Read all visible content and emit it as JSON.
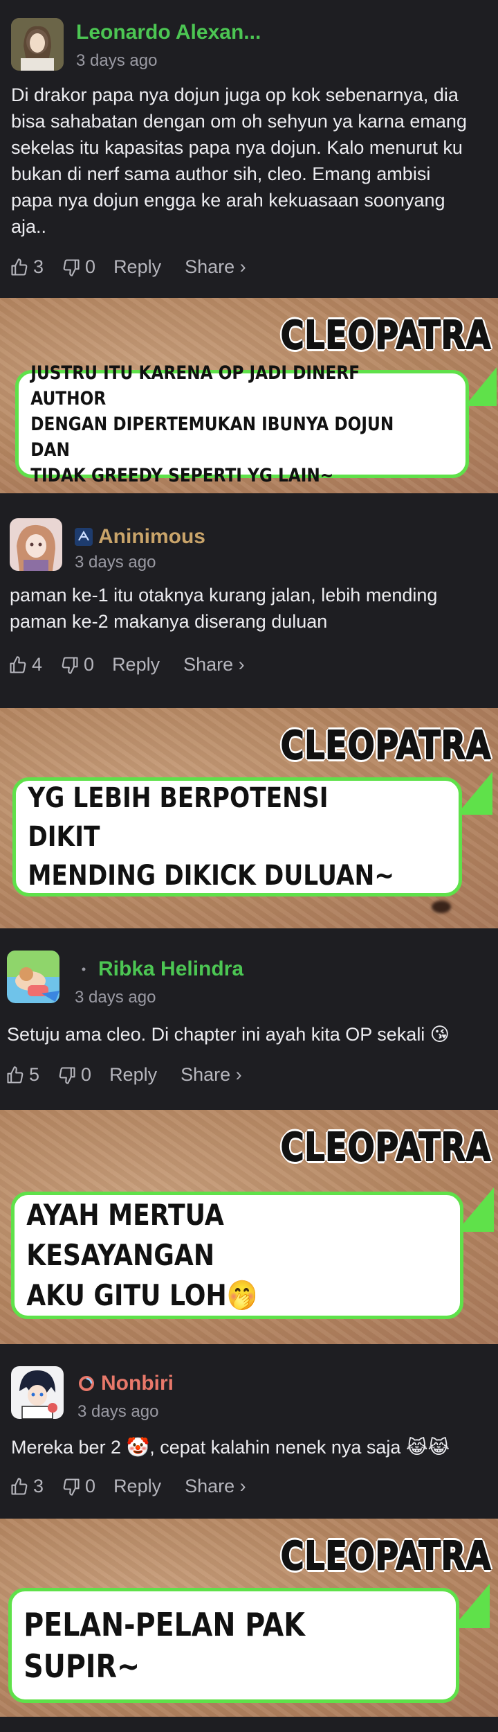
{
  "comments": [
    {
      "author": "Leonardo Alexan...",
      "author_color": "#4cc653",
      "time": "3 days ago",
      "body": "Di drakor papa nya dojun juga op kok sebenarnya, dia\nbisa sahabatan dengan om oh sehyun ya karna emang\nsekelas itu kapasitas papa nya dojun. Kalo menurut ku\nbukan di nerf sama author sih, cleo. Emang ambisi\npapa nya dojun engga ke arah kekuasaan soonyang\naja..",
      "likes": "3",
      "dislikes": "0",
      "reply": "Reply",
      "share": "Share ›",
      "avatar_icon": "user-avatar-icon"
    },
    {
      "author": "Aninimous",
      "author_color": "#c9a46a",
      "time": "3 days ago",
      "body": "paman ke-1 itu otaknya kurang jalan, lebih mending\npaman ke-2 makanya diserang duluan",
      "likes": "4",
      "dislikes": "0",
      "reply": "Reply",
      "share": "Share ›",
      "avatar_icon": "user-avatar-icon",
      "badge_icon": "ninja-badge-icon"
    },
    {
      "author": "Ribka Helindra",
      "author_color": "#4cc653",
      "time": "3 days ago",
      "body": "Setuju ama cleo. Di chapter ini ayah kita OP sekali 😘",
      "likes": "5",
      "dislikes": "0",
      "reply": "Reply",
      "share": "Share ›",
      "avatar_icon": "user-avatar-icon",
      "badge_icon": "dot-badge-icon"
    },
    {
      "author": "Nonbiri",
      "author_color": "#e8786a",
      "time": "3 days ago",
      "body": "Mereka ber 2 🤡, cepat kalahin nenek nya saja 😹😹",
      "likes": "3",
      "dislikes": "0",
      "reply": "Reply",
      "share": "Share ›",
      "avatar_icon": "user-avatar-icon",
      "badge_icon": "swirl-badge-icon"
    }
  ],
  "panels": [
    {
      "speaker": "CLEOPATRA",
      "text": "JUSTRU ITU KARENA OP JADI DINERF AUTHOR\nDENGAN DIPERTEMUKAN IBUNYA DOJUN DAN\nTIDAK GREEDY SEPERTI YG LAIN~"
    },
    {
      "speaker": "CLEOPATRA",
      "text": "YG LEBIH BERPOTENSI DIKIT\nMENDING DIKICK DULUAN~"
    },
    {
      "speaker": "CLEOPATRA",
      "text": "AYAH MERTUA KESAYANGAN\nAKU GITU LOH🤭"
    },
    {
      "speaker": "CLEOPATRA",
      "text": "PELAN-PELAN PAK SUPIR~"
    }
  ],
  "colors": {
    "background": "#1e1e22",
    "bubble_border": "#5fe14a",
    "panel_sand": "#b48560"
  }
}
